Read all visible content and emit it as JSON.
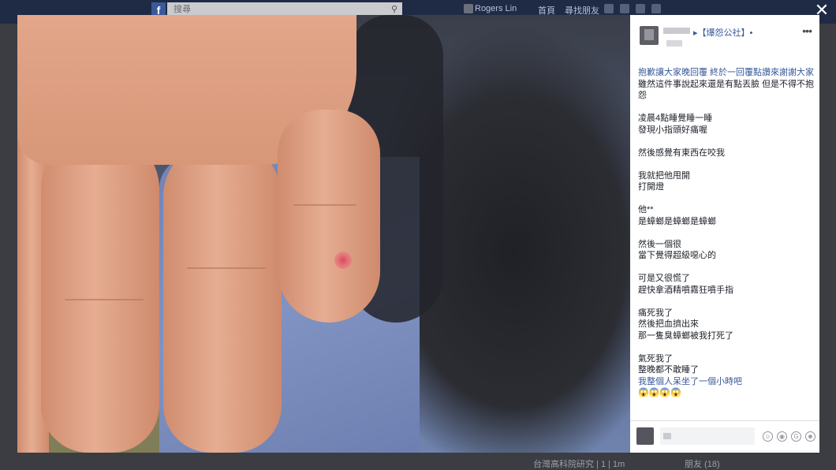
{
  "fb_bar": {
    "logo": "f",
    "search_text": "搜尋",
    "user": "Rogers Lin",
    "home": "首頁",
    "find_friends": "尋找朋友"
  },
  "background": {
    "bottom_left": "",
    "bottom_mid": "台灣高科院研究 | 1 | 1m",
    "bottom_right": "朋友 (18)"
  },
  "lightbox": {
    "close_label": "✕"
  },
  "post": {
    "group": "▸【爆怨公社】•",
    "more": "•••",
    "lines": [
      {
        "text": "抱歉讓大家晚回覆 終於一回覆點讚來謝謝大家",
        "blue": true
      },
      {
        "text": "雖然這件事說起來還是有點丟臉 但是不得不抱怨",
        "blue": false
      },
      {
        "text": "",
        "blue": false
      },
      {
        "text": "凌晨4點睡覺睡一睡",
        "blue": false
      },
      {
        "text": "發現小指頭好痛喔",
        "blue": false
      },
      {
        "text": "",
        "blue": false
      },
      {
        "text": "然後感覺有東西在咬我",
        "blue": false
      },
      {
        "text": "",
        "blue": false
      },
      {
        "text": "我就把他甩開",
        "blue": false
      },
      {
        "text": "打開燈",
        "blue": false
      },
      {
        "text": "",
        "blue": false
      },
      {
        "text": "他**",
        "blue": false
      },
      {
        "text": "是蟑螂是蟑螂是蟑螂",
        "blue": false
      },
      {
        "text": "",
        "blue": false
      },
      {
        "text": "然後一個很",
        "blue": false
      },
      {
        "text": "當下覺得超級噁心的",
        "blue": false
      },
      {
        "text": "",
        "blue": false
      },
      {
        "text": "可是又很慌了",
        "blue": false
      },
      {
        "text": "趕快拿酒精噴霧狂噴手指",
        "blue": false
      },
      {
        "text": "",
        "blue": false
      },
      {
        "text": "痛死我了",
        "blue": false
      },
      {
        "text": "然後把血擠出來",
        "blue": false
      },
      {
        "text": "那一隻臭蟑螂被我打死了",
        "blue": false
      },
      {
        "text": "",
        "blue": false
      },
      {
        "text": "氣死我了",
        "blue": false
      },
      {
        "text": "整晚都不敢睡了",
        "blue": false
      },
      {
        "text": "我整個人呆坐了一個小時吧",
        "blue": true
      },
      {
        "text": "😱😱😱😱",
        "blue": false
      }
    ]
  },
  "comment": {
    "placeholder": "",
    "icons": [
      "emoji-icon",
      "camera-icon",
      "gif-icon",
      "sticker-icon"
    ]
  }
}
